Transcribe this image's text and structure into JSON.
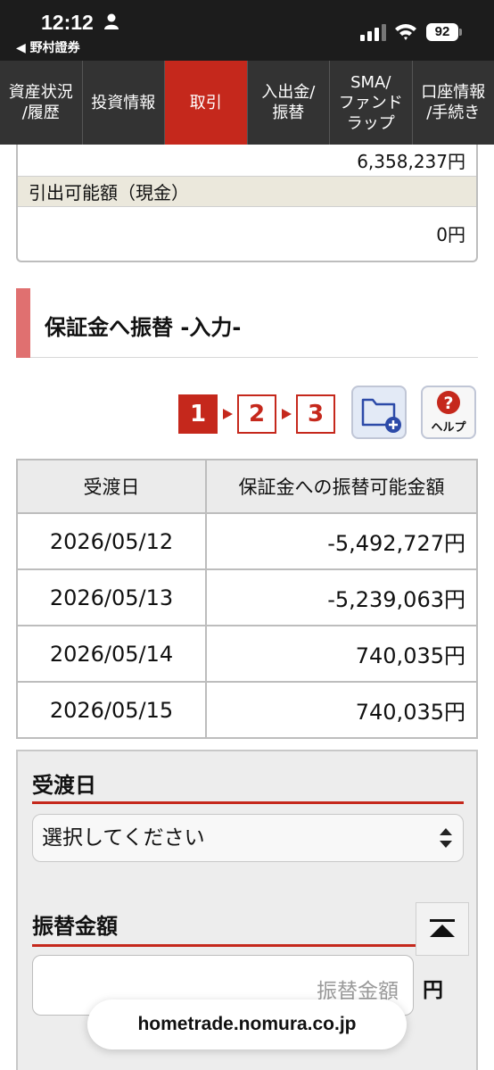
{
  "status_bar": {
    "time": "12:12",
    "back_app": "◀ 野村證券",
    "battery": "92"
  },
  "nav": {
    "items": [
      {
        "label": "資産状況\n/履歴"
      },
      {
        "label": "投資情報"
      },
      {
        "label": "取引"
      },
      {
        "label": "入出金/\n振替"
      },
      {
        "label": "SMA/\nファンド\nラップ"
      },
      {
        "label": "口座情報\n/手続き"
      }
    ]
  },
  "balance": {
    "top_value": "6,358,237円",
    "withdrawable_label": "引出可能額（現金）",
    "withdrawable_value": "0円"
  },
  "section": {
    "title": "保証金へ振替 -入力-"
  },
  "steps": {
    "labels": [
      "1",
      "2",
      "3"
    ],
    "current": 1,
    "help_label": "ヘルプ"
  },
  "table": {
    "headers": [
      "受渡日",
      "保証金への振替可能金額"
    ],
    "rows": [
      [
        "2026/05/12",
        "-5,492,727円"
      ],
      [
        "2026/05/13",
        "-5,239,063円"
      ],
      [
        "2026/05/14",
        "740,035円"
      ],
      [
        "2026/05/15",
        "740,035円"
      ]
    ]
  },
  "form": {
    "date_label": "受渡日",
    "date_select_value": "選択してください",
    "amount_label": "振替金額",
    "amount_placeholder": "振替金額",
    "amount_unit": "円"
  },
  "browser": {
    "url": "hometrade.nomura.co.jp"
  },
  "colors": {
    "brand_red": "#c5281c",
    "nav_bg": "#333333",
    "section_bar": "#e07070"
  }
}
